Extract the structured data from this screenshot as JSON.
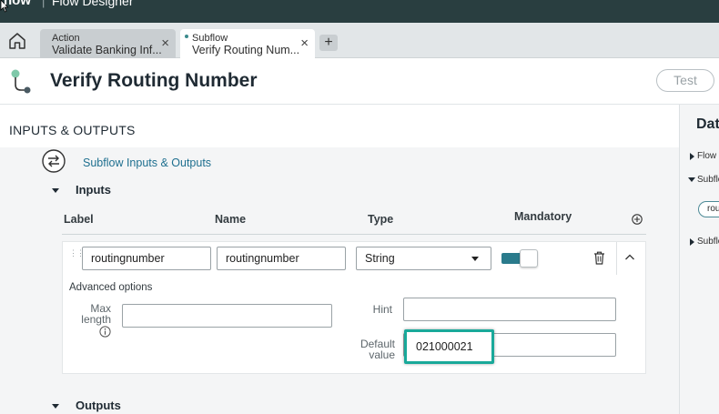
{
  "topbar": {
    "logo": "now",
    "app_title": "Flow Designer"
  },
  "tabs": [
    {
      "type": "Action",
      "name": "Validate Banking Inf...",
      "close": "×"
    },
    {
      "type": "Subflow",
      "name": "Verify Routing Num...",
      "close": "×"
    }
  ],
  "add_tab": "+",
  "header": {
    "title": "Verify Routing Number",
    "test_label": "Test"
  },
  "section": {
    "title": "INPUTS & OUTPUTS",
    "io_link": "Subflow Inputs & Outputs"
  },
  "inputs": {
    "label": "Inputs",
    "columns": {
      "label": "Label",
      "name": "Name",
      "type": "Type",
      "mandatory": "Mandatory"
    },
    "row": {
      "label_value": "routingnumber",
      "name_value": "routingnumber",
      "type_value": "String",
      "mandatory": true
    },
    "advanced": {
      "title": "Advanced options",
      "max_length_label": "Max length",
      "max_length_value": "",
      "hint_label": "Hint",
      "hint_value": "",
      "default_label": "Default value",
      "default_value": "021000021"
    }
  },
  "outputs": {
    "label": "Outputs"
  },
  "right_panel": {
    "title": "Data",
    "items": [
      "Flow Variables",
      "Subflow Inputs",
      "Subflow Outputs"
    ],
    "pill": "routingnumber"
  },
  "colors": {
    "accent": "#2a7b8c",
    "highlight": "#19a99a",
    "topbar": "#293e40",
    "link": "#1e6f8f"
  }
}
